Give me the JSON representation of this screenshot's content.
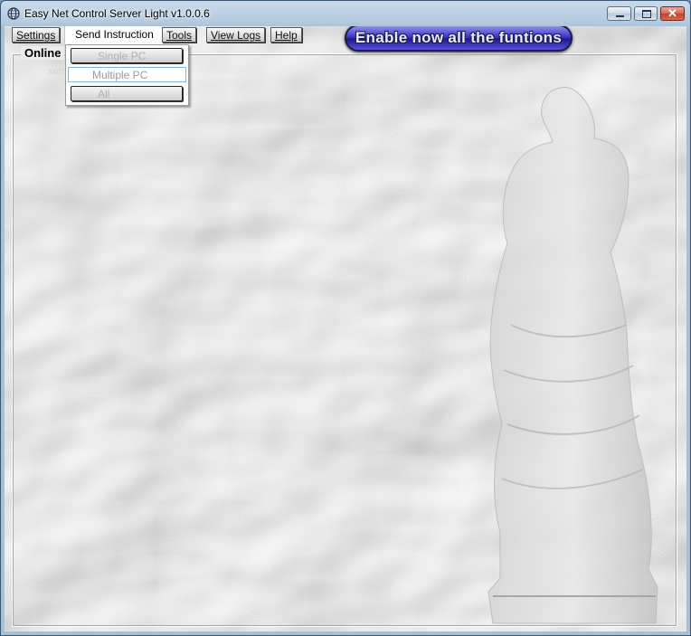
{
  "window": {
    "title": "Easy Net Control Server Light v1.0.0.6",
    "minimize_glyph": "–",
    "maximize_glyph": "□",
    "close_glyph": "✕"
  },
  "menu": {
    "settings": "Settings",
    "send_instruction": "Send Instruction",
    "tools": "Tools",
    "view_logs": "View Logs",
    "help": "Help"
  },
  "banner": {
    "text": "Enable now all the funtions"
  },
  "group": {
    "label": "Online",
    "watermark": "softpedia"
  },
  "dropdown": {
    "items": [
      {
        "label": "Single PC"
      },
      {
        "label": "Multiple PC"
      },
      {
        "label": "All"
      }
    ]
  },
  "icons": {
    "app": "globe-icon"
  },
  "colors": {
    "titlebar": "#b3c9de",
    "banner": "#3c37c9",
    "close": "#c2412c"
  }
}
